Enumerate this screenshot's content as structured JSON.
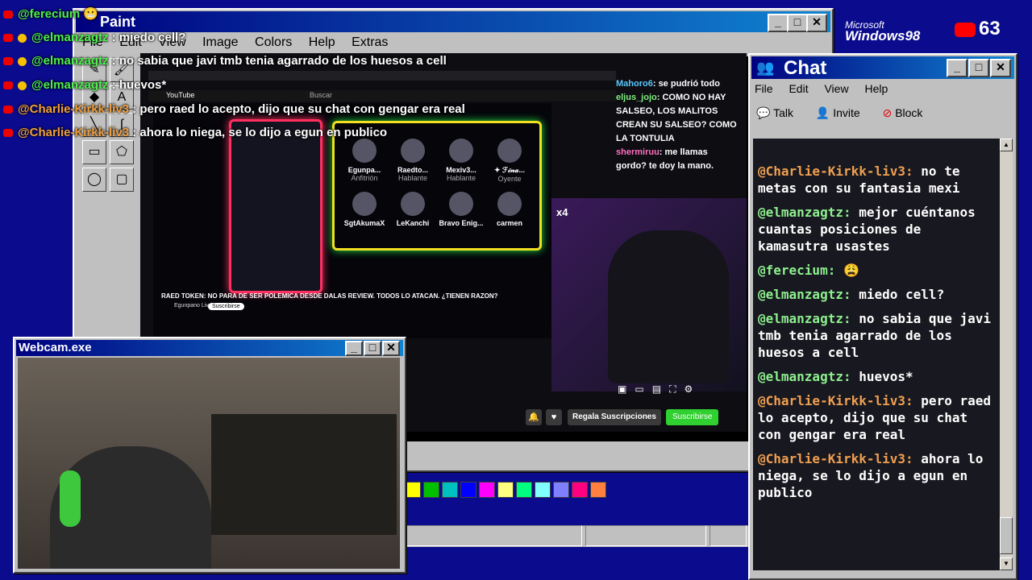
{
  "overlay_chat": [
    {
      "user": "@ferecium",
      "text": ""
    },
    {
      "user": "@elmanzagtz",
      "text": "miedo cell?"
    },
    {
      "user": "@elmanzagtz",
      "text": "no sabia que javi tmb tenia agarrado de los huesos a cell"
    },
    {
      "user": "@elmanzagtz",
      "text": "huevos*"
    },
    {
      "user": "@Charlie-Kirkk-liv3",
      "text": "pero raed lo acepto, dijo que su chat con gengar era real"
    },
    {
      "user": "@Charlie-Kirkk-liv3",
      "text": "ahora lo niega, se lo dijo a egun en publico"
    }
  ],
  "badge": {
    "windows_brand_top": "Microsoft",
    "windows_brand": "Windows98",
    "viewer_count": "63"
  },
  "paint": {
    "title": "Paint",
    "menu": [
      "File",
      "Edit",
      "View",
      "Image",
      "Colors",
      "Help",
      "Extras"
    ],
    "palette": [
      "#ffff00",
      "#00c000",
      "#00c0c0",
      "#0000ff",
      "#ff00ff",
      "#ffff80",
      "#00ff80",
      "#80ffff",
      "#8080ff",
      "#ff0080",
      "#ff8040"
    ]
  },
  "stream_video": {
    "site": "YouTube",
    "search": "Buscar",
    "participants": [
      {
        "name": "Egunpa...",
        "role": "Anfitrión"
      },
      {
        "name": "Raedto...",
        "role": "Hablante"
      },
      {
        "name": "Mexiv3...",
        "role": "Hablante"
      },
      {
        "name": "✦ ℱ𝒾𝓃𝒶...",
        "role": "Oyente"
      },
      {
        "name": "SgtAkumaX",
        "role": ""
      },
      {
        "name": "LeKanchi",
        "role": ""
      },
      {
        "name": "Bravo Enig...",
        "role": ""
      },
      {
        "name": "carmen",
        "role": ""
      }
    ],
    "video_title": "RAED TOKEN: NO PARA DE SER POLEMICA DESDE DALAS REVIEW. TODOS LO ATACAN. ¿TIENEN RAZON?",
    "channel": "Egunpano Live",
    "subscribe_small": "Suscribirse",
    "side_chat": [
      {
        "user": "Mahoro6",
        "text": ": se pudrió todo"
      },
      {
        "user": "eljus_jojo",
        "text": ": COMO NO HAY SALSEO, LOS MALITOS CREAN SU SALSEO? COMO LA TONTULIA"
      },
      {
        "user": "shermiruu",
        "text": ": me llamas gordo? te doy la mano."
      }
    ],
    "multiplier": "x4",
    "gift_button": "Regala Suscripciones",
    "subscribe_button": "Suscribirse"
  },
  "webcam": {
    "title": "Webcam.exe"
  },
  "chat_window": {
    "title": "Chat",
    "menu": [
      "File",
      "Edit",
      "View",
      "Help"
    ],
    "toolbar": [
      "Talk",
      "Invite",
      "Block"
    ],
    "messages": [
      {
        "user": "@Charlie-Kirkk-liv3:",
        "text": "no te metas con su fantasia mexi"
      },
      {
        "user": "@elmanzagtz:",
        "text": "mejor cuéntanos cuantas posiciones de kamasutra usastes"
      },
      {
        "user": "@ferecium:",
        "text": "😩"
      },
      {
        "user": "@elmanzagtz:",
        "text": "miedo cell?"
      },
      {
        "user": "@elmanzagtz:",
        "text": "no sabia que javi tmb tenia agarrado de los huesos a cell"
      },
      {
        "user": "@elmanzagtz:",
        "text": "huevos*"
      },
      {
        "user": "@Charlie-Kirkk-liv3:",
        "text": "pero raed lo acepto, dijo que su chat con gengar era real"
      },
      {
        "user": "@Charlie-Kirkk-liv3:",
        "text": "ahora lo niega, se lo dijo a egun en publico"
      }
    ]
  }
}
